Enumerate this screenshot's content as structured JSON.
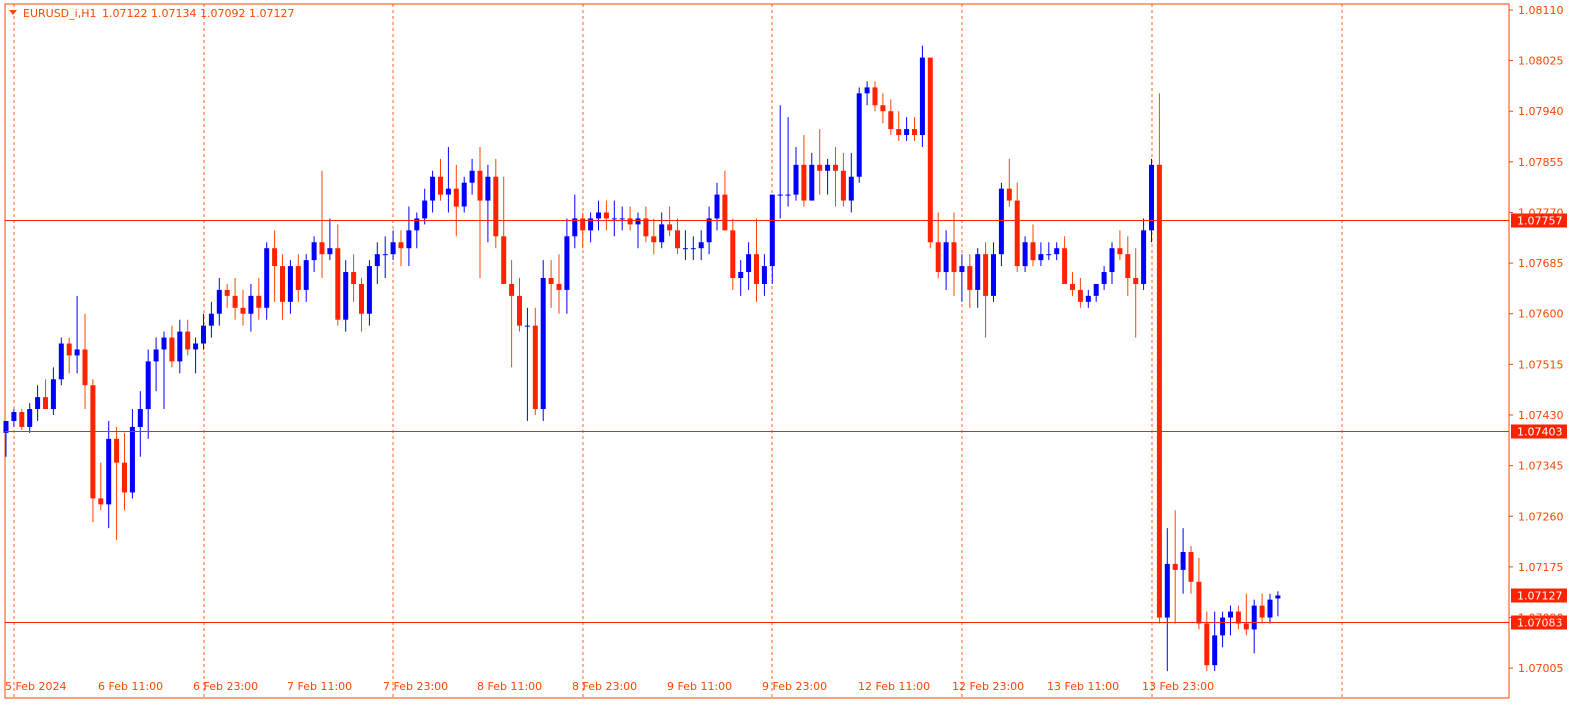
{
  "header": {
    "symbol": "EURUSD_i,H1",
    "ohlc": "1.07122 1.07134 1.07092 1.07127"
  },
  "colors": {
    "frame": "#FF4500",
    "grid": "#FF4500",
    "bull": "#0000FF",
    "bear": "#FF2200",
    "wick_up": "#0000FF",
    "wick_down": "#FF4500",
    "hline": "#FF2200",
    "label_bg": "#FF2200",
    "label_text": "#FFFFFF",
    "axis_text": "#FF4500"
  },
  "chart_data": {
    "type": "candlestick",
    "symbol": "EURUSD_i",
    "timeframe": "H1",
    "ylim": [
      1.0697,
      1.0812
    ],
    "y_ticks": [
      "1.08110",
      "1.08025",
      "1.07940",
      "1.07855",
      "1.07770",
      "1.07685",
      "1.07600",
      "1.07515",
      "1.07430",
      "1.07345",
      "1.07260",
      "1.07175",
      "1.07090",
      "1.07005"
    ],
    "x_ticks": [
      "5 Feb 2024",
      "6 Feb 11:00",
      "6 Feb 23:00",
      "7 Feb 11:00",
      "7 Feb 23:00",
      "8 Feb 11:00",
      "8 Feb 23:00",
      "9 Feb 11:00",
      "9 Feb 23:00",
      "12 Feb 11:00",
      "12 Feb 23:00",
      "13 Feb 11:00",
      "13 Feb 23:00"
    ],
    "horizontal_lines": [
      {
        "price": "1.07757"
      },
      {
        "price": "1.07403"
      },
      {
        "price": "1.07083"
      }
    ],
    "current_price": "1.07127",
    "candles": [
      {
        "o": 1.074,
        "h": 1.0742,
        "l": 1.0736,
        "c": 1.0742
      },
      {
        "o": 1.0742,
        "h": 1.0744,
        "l": 1.0741,
        "c": 1.07435
      },
      {
        "o": 1.07435,
        "h": 1.0744,
        "l": 1.07405,
        "c": 1.0741
      },
      {
        "o": 1.0741,
        "h": 1.0745,
        "l": 1.074,
        "c": 1.0744
      },
      {
        "o": 1.0744,
        "h": 1.0748,
        "l": 1.0742,
        "c": 1.0746
      },
      {
        "o": 1.0746,
        "h": 1.0749,
        "l": 1.0744,
        "c": 1.0744
      },
      {
        "o": 1.0744,
        "h": 1.0751,
        "l": 1.0743,
        "c": 1.0749
      },
      {
        "o": 1.0749,
        "h": 1.0756,
        "l": 1.0748,
        "c": 1.0755
      },
      {
        "o": 1.0755,
        "h": 1.0756,
        "l": 1.075,
        "c": 1.0753
      },
      {
        "o": 1.0753,
        "h": 1.0763,
        "l": 1.075,
        "c": 1.0754
      },
      {
        "o": 1.0754,
        "h": 1.076,
        "l": 1.0744,
        "c": 1.0748
      },
      {
        "o": 1.0748,
        "h": 1.0749,
        "l": 1.0725,
        "c": 1.0729
      },
      {
        "o": 1.0729,
        "h": 1.0735,
        "l": 1.0727,
        "c": 1.0728
      },
      {
        "o": 1.0728,
        "h": 1.0742,
        "l": 1.0724,
        "c": 1.0739
      },
      {
        "o": 1.0739,
        "h": 1.0741,
        "l": 1.0722,
        "c": 1.0735
      },
      {
        "o": 1.0735,
        "h": 1.074,
        "l": 1.0727,
        "c": 1.073
      },
      {
        "o": 1.073,
        "h": 1.0744,
        "l": 1.0729,
        "c": 1.0741
      },
      {
        "o": 1.0741,
        "h": 1.0747,
        "l": 1.0736,
        "c": 1.0744
      },
      {
        "o": 1.0744,
        "h": 1.0754,
        "l": 1.0739,
        "c": 1.0752
      },
      {
        "o": 1.0752,
        "h": 1.0756,
        "l": 1.0747,
        "c": 1.0754
      },
      {
        "o": 1.0754,
        "h": 1.0757,
        "l": 1.0744,
        "c": 1.0756
      },
      {
        "o": 1.0756,
        "h": 1.0758,
        "l": 1.0751,
        "c": 1.0752
      },
      {
        "o": 1.0752,
        "h": 1.0759,
        "l": 1.075,
        "c": 1.0757
      },
      {
        "o": 1.0757,
        "h": 1.0759,
        "l": 1.0753,
        "c": 1.0754
      },
      {
        "o": 1.0754,
        "h": 1.0756,
        "l": 1.075,
        "c": 1.0755
      },
      {
        "o": 1.0755,
        "h": 1.076,
        "l": 1.0754,
        "c": 1.0758
      },
      {
        "o": 1.0758,
        "h": 1.0762,
        "l": 1.0756,
        "c": 1.076
      },
      {
        "o": 1.076,
        "h": 1.0766,
        "l": 1.0758,
        "c": 1.0764
      },
      {
        "o": 1.0764,
        "h": 1.0765,
        "l": 1.0761,
        "c": 1.0763
      },
      {
        "o": 1.0763,
        "h": 1.0766,
        "l": 1.0759,
        "c": 1.0761
      },
      {
        "o": 1.0761,
        "h": 1.0764,
        "l": 1.0758,
        "c": 1.076
      },
      {
        "o": 1.076,
        "h": 1.0765,
        "l": 1.0757,
        "c": 1.0763
      },
      {
        "o": 1.0763,
        "h": 1.0766,
        "l": 1.0759,
        "c": 1.0761
      },
      {
        "o": 1.0761,
        "h": 1.0772,
        "l": 1.0759,
        "c": 1.0771
      },
      {
        "o": 1.0771,
        "h": 1.0774,
        "l": 1.0762,
        "c": 1.0768
      },
      {
        "o": 1.0768,
        "h": 1.077,
        "l": 1.0759,
        "c": 1.0762
      },
      {
        "o": 1.0762,
        "h": 1.0769,
        "l": 1.076,
        "c": 1.0768
      },
      {
        "o": 1.0768,
        "h": 1.077,
        "l": 1.0762,
        "c": 1.0764
      },
      {
        "o": 1.0764,
        "h": 1.077,
        "l": 1.0762,
        "c": 1.0769
      },
      {
        "o": 1.0769,
        "h": 1.0773,
        "l": 1.0767,
        "c": 1.0772
      },
      {
        "o": 1.0772,
        "h": 1.0784,
        "l": 1.0766,
        "c": 1.077
      },
      {
        "o": 1.077,
        "h": 1.0776,
        "l": 1.0769,
        "c": 1.0771
      },
      {
        "o": 1.0771,
        "h": 1.0775,
        "l": 1.0758,
        "c": 1.0759
      },
      {
        "o": 1.0759,
        "h": 1.0769,
        "l": 1.0757,
        "c": 1.0767
      },
      {
        "o": 1.0767,
        "h": 1.077,
        "l": 1.0762,
        "c": 1.0765
      },
      {
        "o": 1.0765,
        "h": 1.0766,
        "l": 1.0757,
        "c": 1.076
      },
      {
        "o": 1.076,
        "h": 1.0769,
        "l": 1.0758,
        "c": 1.0768
      },
      {
        "o": 1.0768,
        "h": 1.0772,
        "l": 1.0765,
        "c": 1.077
      },
      {
        "o": 1.077,
        "h": 1.0773,
        "l": 1.0766,
        "c": 1.077
      },
      {
        "o": 1.077,
        "h": 1.0774,
        "l": 1.0769,
        "c": 1.0772
      },
      {
        "o": 1.0772,
        "h": 1.0774,
        "l": 1.0768,
        "c": 1.0771
      },
      {
        "o": 1.0771,
        "h": 1.0778,
        "l": 1.0768,
        "c": 1.0774
      },
      {
        "o": 1.0774,
        "h": 1.0777,
        "l": 1.0771,
        "c": 1.0776
      },
      {
        "o": 1.0776,
        "h": 1.0781,
        "l": 1.0775,
        "c": 1.0779
      },
      {
        "o": 1.0779,
        "h": 1.0784,
        "l": 1.0777,
        "c": 1.0783
      },
      {
        "o": 1.0783,
        "h": 1.0786,
        "l": 1.0779,
        "c": 1.078
      },
      {
        "o": 1.078,
        "h": 1.0788,
        "l": 1.0777,
        "c": 1.0781
      },
      {
        "o": 1.0781,
        "h": 1.0785,
        "l": 1.0773,
        "c": 1.0778
      },
      {
        "o": 1.0778,
        "h": 1.0783,
        "l": 1.0777,
        "c": 1.0782
      },
      {
        "o": 1.0782,
        "h": 1.0786,
        "l": 1.078,
        "c": 1.0784
      },
      {
        "o": 1.0784,
        "h": 1.0788,
        "l": 1.0766,
        "c": 1.0779
      },
      {
        "o": 1.0779,
        "h": 1.0785,
        "l": 1.0772,
        "c": 1.0783
      },
      {
        "o": 1.0783,
        "h": 1.0786,
        "l": 1.0771,
        "c": 1.0773
      },
      {
        "o": 1.0773,
        "h": 1.0783,
        "l": 1.077,
        "c": 1.0765
      },
      {
        "o": 1.0765,
        "h": 1.0769,
        "l": 1.0751,
        "c": 1.0763
      },
      {
        "o": 1.0763,
        "h": 1.0766,
        "l": 1.0757,
        "c": 1.0758
      },
      {
        "o": 1.0758,
        "h": 1.0761,
        "l": 1.0742,
        "c": 1.0758
      },
      {
        "o": 1.0758,
        "h": 1.0761,
        "l": 1.0743,
        "c": 1.0744
      },
      {
        "o": 1.0744,
        "h": 1.0769,
        "l": 1.0742,
        "c": 1.0766
      },
      {
        "o": 1.0766,
        "h": 1.0769,
        "l": 1.0761,
        "c": 1.0765
      },
      {
        "o": 1.0765,
        "h": 1.077,
        "l": 1.076,
        "c": 1.0764
      },
      {
        "o": 1.0764,
        "h": 1.0776,
        "l": 1.076,
        "c": 1.0773
      },
      {
        "o": 1.0773,
        "h": 1.078,
        "l": 1.0771,
        "c": 1.0776
      },
      {
        "o": 1.0776,
        "h": 1.0777,
        "l": 1.0771,
        "c": 1.0774
      },
      {
        "o": 1.0774,
        "h": 1.0777,
        "l": 1.0772,
        "c": 1.0776
      },
      {
        "o": 1.0776,
        "h": 1.0779,
        "l": 1.0774,
        "c": 1.0777
      },
      {
        "o": 1.0777,
        "h": 1.0779,
        "l": 1.0774,
        "c": 1.0776
      },
      {
        "o": 1.0776,
        "h": 1.0779,
        "l": 1.0773,
        "c": 1.0776
      },
      {
        "o": 1.0776,
        "h": 1.0778,
        "l": 1.0774,
        "c": 1.0776
      },
      {
        "o": 1.0776,
        "h": 1.0778,
        "l": 1.0774,
        "c": 1.0775
      },
      {
        "o": 1.0775,
        "h": 1.0777,
        "l": 1.0771,
        "c": 1.0776
      },
      {
        "o": 1.0776,
        "h": 1.0778,
        "l": 1.0772,
        "c": 1.0773
      },
      {
        "o": 1.0773,
        "h": 1.0776,
        "l": 1.077,
        "c": 1.0772
      },
      {
        "o": 1.0772,
        "h": 1.0777,
        "l": 1.0771,
        "c": 1.0775
      },
      {
        "o": 1.0775,
        "h": 1.0778,
        "l": 1.0773,
        "c": 1.0774
      },
      {
        "o": 1.0774,
        "h": 1.0776,
        "l": 1.077,
        "c": 1.0771
      },
      {
        "o": 1.0771,
        "h": 1.0774,
        "l": 1.0769,
        "c": 1.0771
      },
      {
        "o": 1.0771,
        "h": 1.0773,
        "l": 1.0769,
        "c": 1.0771
      },
      {
        "o": 1.0771,
        "h": 1.0774,
        "l": 1.0769,
        "c": 1.0772
      },
      {
        "o": 1.0772,
        "h": 1.0778,
        "l": 1.077,
        "c": 1.0776
      },
      {
        "o": 1.0776,
        "h": 1.0782,
        "l": 1.0774,
        "c": 1.078
      },
      {
        "o": 1.078,
        "h": 1.0784,
        "l": 1.0774,
        "c": 1.0774
      },
      {
        "o": 1.0774,
        "h": 1.0776,
        "l": 1.0764,
        "c": 1.0766
      },
      {
        "o": 1.0766,
        "h": 1.0769,
        "l": 1.0763,
        "c": 1.0767
      },
      {
        "o": 1.0767,
        "h": 1.0772,
        "l": 1.0764,
        "c": 1.077
      },
      {
        "o": 1.077,
        "h": 1.0776,
        "l": 1.0762,
        "c": 1.0765
      },
      {
        "o": 1.0765,
        "h": 1.077,
        "l": 1.0763,
        "c": 1.0768
      },
      {
        "o": 1.0768,
        "h": 1.078,
        "l": 1.0765,
        "c": 1.078
      },
      {
        "o": 1.078,
        "h": 1.0795,
        "l": 1.0776,
        "c": 1.078
      },
      {
        "o": 1.078,
        "h": 1.0793,
        "l": 1.0778,
        "c": 1.078
      },
      {
        "o": 1.078,
        "h": 1.0788,
        "l": 1.0779,
        "c": 1.0785
      },
      {
        "o": 1.0785,
        "h": 1.079,
        "l": 1.0778,
        "c": 1.0779
      },
      {
        "o": 1.0779,
        "h": 1.0787,
        "l": 1.0779,
        "c": 1.0785
      },
      {
        "o": 1.0785,
        "h": 1.0791,
        "l": 1.078,
        "c": 1.0784
      },
      {
        "o": 1.0784,
        "h": 1.0786,
        "l": 1.078,
        "c": 1.0785
      },
      {
        "o": 1.0785,
        "h": 1.0788,
        "l": 1.0778,
        "c": 1.0784
      },
      {
        "o": 1.0784,
        "h": 1.0787,
        "l": 1.0778,
        "c": 1.0779
      },
      {
        "o": 1.0779,
        "h": 1.0787,
        "l": 1.0777,
        "c": 1.0783
      },
      {
        "o": 1.0783,
        "h": 1.0798,
        "l": 1.0782,
        "c": 1.0797
      },
      {
        "o": 1.0797,
        "h": 1.0799,
        "l": 1.0795,
        "c": 1.0798
      },
      {
        "o": 1.0798,
        "h": 1.0799,
        "l": 1.0794,
        "c": 1.0795
      },
      {
        "o": 1.0795,
        "h": 1.0797,
        "l": 1.0792,
        "c": 1.0794
      },
      {
        "o": 1.0794,
        "h": 1.0796,
        "l": 1.079,
        "c": 1.0791
      },
      {
        "o": 1.0791,
        "h": 1.0794,
        "l": 1.0789,
        "c": 1.079
      },
      {
        "o": 1.079,
        "h": 1.0793,
        "l": 1.0789,
        "c": 1.0791
      },
      {
        "o": 1.0791,
        "h": 1.0793,
        "l": 1.0789,
        "c": 1.079
      },
      {
        "o": 1.079,
        "h": 1.0805,
        "l": 1.0788,
        "c": 1.0803
      },
      {
        "o": 1.0803,
        "h": 1.0803,
        "l": 1.0771,
        "c": 1.0772
      },
      {
        "o": 1.0772,
        "h": 1.0777,
        "l": 1.0766,
        "c": 1.0767
      },
      {
        "o": 1.0767,
        "h": 1.0774,
        "l": 1.0764,
        "c": 1.0772
      },
      {
        "o": 1.0772,
        "h": 1.0777,
        "l": 1.0763,
        "c": 1.0767
      },
      {
        "o": 1.0767,
        "h": 1.077,
        "l": 1.0762,
        "c": 1.0768
      },
      {
        "o": 1.0768,
        "h": 1.077,
        "l": 1.0761,
        "c": 1.0764
      },
      {
        "o": 1.0764,
        "h": 1.0771,
        "l": 1.0761,
        "c": 1.077
      },
      {
        "o": 1.077,
        "h": 1.0772,
        "l": 1.0756,
        "c": 1.0763
      },
      {
        "o": 1.0763,
        "h": 1.0772,
        "l": 1.0762,
        "c": 1.077
      },
      {
        "o": 1.077,
        "h": 1.0782,
        "l": 1.0768,
        "c": 1.0781
      },
      {
        "o": 1.0781,
        "h": 1.0786,
        "l": 1.0778,
        "c": 1.0779
      },
      {
        "o": 1.0779,
        "h": 1.0782,
        "l": 1.0767,
        "c": 1.0768
      },
      {
        "o": 1.0768,
        "h": 1.0773,
        "l": 1.0767,
        "c": 1.0772
      },
      {
        "o": 1.0772,
        "h": 1.0775,
        "l": 1.0768,
        "c": 1.0769
      },
      {
        "o": 1.0769,
        "h": 1.0772,
        "l": 1.0768,
        "c": 1.077
      },
      {
        "o": 1.077,
        "h": 1.0772,
        "l": 1.0769,
        "c": 1.077
      },
      {
        "o": 1.077,
        "h": 1.0772,
        "l": 1.0769,
        "c": 1.0771
      },
      {
        "o": 1.0771,
        "h": 1.0773,
        "l": 1.0765,
        "c": 1.0765
      },
      {
        "o": 1.0765,
        "h": 1.0767,
        "l": 1.0763,
        "c": 1.0764
      },
      {
        "o": 1.0764,
        "h": 1.0766,
        "l": 1.0761,
        "c": 1.0762
      },
      {
        "o": 1.0762,
        "h": 1.0764,
        "l": 1.0761,
        "c": 1.0763
      },
      {
        "o": 1.0763,
        "h": 1.0765,
        "l": 1.0762,
        "c": 1.0765
      },
      {
        "o": 1.0765,
        "h": 1.0768,
        "l": 1.0764,
        "c": 1.0767
      },
      {
        "o": 1.0767,
        "h": 1.0772,
        "l": 1.0765,
        "c": 1.0771
      },
      {
        "o": 1.0771,
        "h": 1.0774,
        "l": 1.0769,
        "c": 1.077
      },
      {
        "o": 1.077,
        "h": 1.0773,
        "l": 1.0763,
        "c": 1.0766
      },
      {
        "o": 1.0766,
        "h": 1.0771,
        "l": 1.0756,
        "c": 1.0765
      },
      {
        "o": 1.0765,
        "h": 1.0776,
        "l": 1.0764,
        "c": 1.0774
      },
      {
        "o": 1.0774,
        "h": 1.0786,
        "l": 1.0772,
        "c": 1.0785
      },
      {
        "o": 1.0785,
        "h": 1.0797,
        "l": 1.0708,
        "c": 1.0709
      },
      {
        "o": 1.0709,
        "h": 1.0724,
        "l": 1.07,
        "c": 1.0718
      },
      {
        "o": 1.0718,
        "h": 1.0727,
        "l": 1.0708,
        "c": 1.0717
      },
      {
        "o": 1.0717,
        "h": 1.0724,
        "l": 1.0713,
        "c": 1.072
      },
      {
        "o": 1.072,
        "h": 1.0721,
        "l": 1.0713,
        "c": 1.0715
      },
      {
        "o": 1.0715,
        "h": 1.0719,
        "l": 1.0707,
        "c": 1.0708
      },
      {
        "o": 1.0708,
        "h": 1.071,
        "l": 1.07,
        "c": 1.0701
      },
      {
        "o": 1.0701,
        "h": 1.071,
        "l": 1.07,
        "c": 1.0706
      },
      {
        "o": 1.0706,
        "h": 1.071,
        "l": 1.0704,
        "c": 1.0709
      },
      {
        "o": 1.0709,
        "h": 1.0711,
        "l": 1.0706,
        "c": 1.071
      },
      {
        "o": 1.071,
        "h": 1.0711,
        "l": 1.0707,
        "c": 1.0708
      },
      {
        "o": 1.0708,
        "h": 1.0713,
        "l": 1.0706,
        "c": 1.0707
      },
      {
        "o": 1.0707,
        "h": 1.0712,
        "l": 1.0703,
        "c": 1.0711
      },
      {
        "o": 1.0711,
        "h": 1.0713,
        "l": 1.0708,
        "c": 1.0709
      },
      {
        "o": 1.0709,
        "h": 1.0713,
        "l": 1.0708,
        "c": 1.0712
      },
      {
        "o": 1.07122,
        "h": 1.07134,
        "l": 1.07092,
        "c": 1.07127
      }
    ]
  }
}
